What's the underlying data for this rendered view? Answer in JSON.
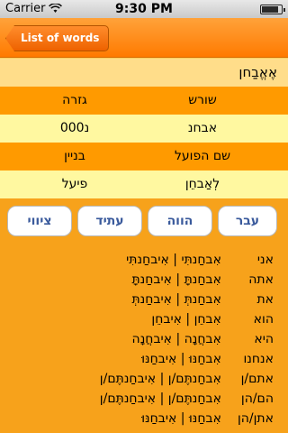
{
  "status_bar": {
    "carrier": "Carrier",
    "time": "9:30 PM",
    "battery_level": 0.85
  },
  "nav": {
    "back_label": "List of words"
  },
  "word": "אֶאֱבַחן",
  "info": {
    "root_header": "שורש",
    "gizra_header": "גזרה",
    "root_value": "אבחנ",
    "gizra_value": "נ000",
    "infinitive_header": "שם הפועל",
    "binyan_header": "בניין",
    "infinitive_value": "לְאַבחֵן",
    "binyan_value": "פיעל"
  },
  "tenses": {
    "past": "עבר",
    "present": "הווה",
    "future": "עתיד",
    "imperative": "ציווי"
  },
  "conjugation": [
    {
      "pronoun": "אני",
      "forms": "אִבחַנתִּי | אִיבחַנתִּי"
    },
    {
      "pronoun": "אתה",
      "forms": "אִבחַנתָּ | אִיבחַנתָּ"
    },
    {
      "pronoun": "את",
      "forms": "אִבחַנתְּ | אִיבחַנתְּ"
    },
    {
      "pronoun": "הוא",
      "forms": "אִבחֵן | אִיבחֵן"
    },
    {
      "pronoun": "היא",
      "forms": "אִבחֲנָה | אִיבחֲנָה"
    },
    {
      "pronoun": "אנחנו",
      "forms": "אִבחַנּוּ | אִיבחַנּוּ"
    },
    {
      "pronoun": "אתם/ן",
      "forms": "אִבחַנתֶּם/ן | אִיבחַנתֶּם/ן"
    },
    {
      "pronoun": "הם/הן",
      "forms": "אִבחַנתֶּם/ן | אִיבחַנתֶּם/ן"
    },
    {
      "pronoun": "אתן/הן",
      "forms": "אִבחַנּוּ | אִיבחַנּוּ"
    }
  ]
}
